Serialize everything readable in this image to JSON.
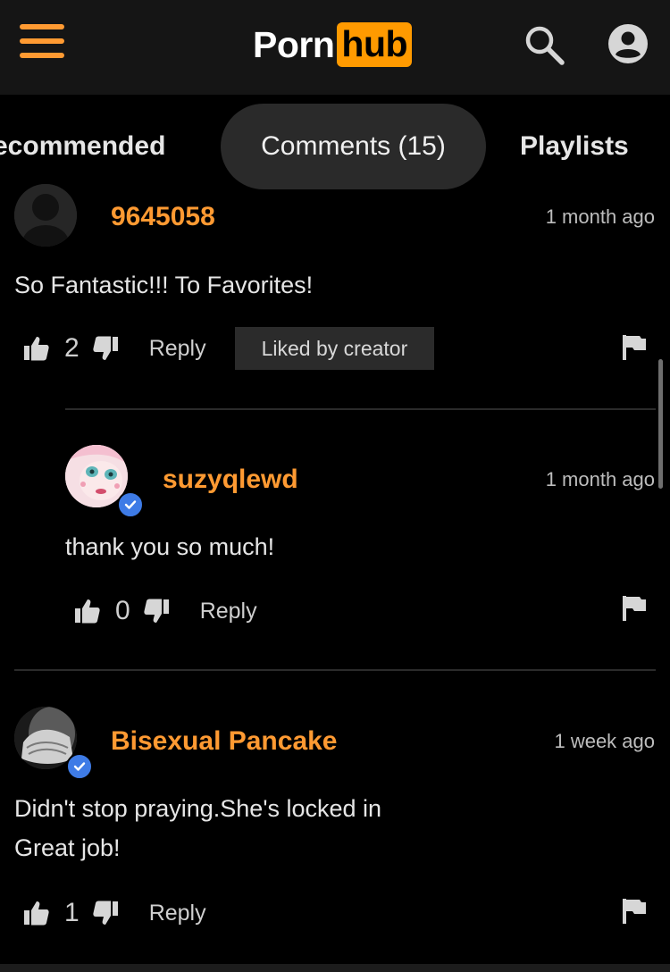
{
  "header": {
    "logo_porn": "Porn",
    "logo_hub": "hub",
    "accent_color": "#ff9a00",
    "icons": [
      "menu-icon",
      "search-icon",
      "account-icon"
    ]
  },
  "tabs": [
    {
      "label": "ecommended"
    },
    {
      "label": "Comments (15)",
      "active": true
    },
    {
      "label": "Playlists"
    }
  ],
  "comments": [
    {
      "username": "9645058",
      "time": "1 month ago",
      "text": "So Fantastic!!! To Favorites!",
      "likes": "2",
      "reply": "Reply",
      "badge": "Liked by creator",
      "replies": [
        {
          "username": "suzyqlewd",
          "verified": true,
          "time": "1 month ago",
          "text": "thank you so much!",
          "likes": "0",
          "reply": "Reply"
        }
      ]
    },
    {
      "username": "Bisexual Pancake",
      "verified": true,
      "time": "1 week ago",
      "text_line1": "Didn't stop praying.She's locked in",
      "text_line2": "Great job!",
      "likes": "1",
      "reply": "Reply"
    }
  ]
}
